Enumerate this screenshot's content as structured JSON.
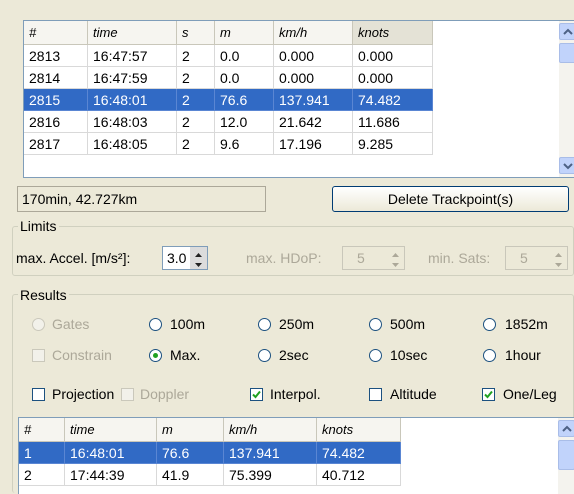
{
  "top_table": {
    "columns": [
      "#",
      "time",
      "s",
      "m",
      "km/h",
      "knots"
    ],
    "rows": [
      [
        "2813",
        "16:47:57",
        "2",
        "0.0",
        "0.000",
        "0.000"
      ],
      [
        "2814",
        "16:47:59",
        "2",
        "0.0",
        "0.000",
        "0.000"
      ],
      [
        "2815",
        "16:48:01",
        "2",
        "76.6",
        "137.941",
        "74.482"
      ],
      [
        "2816",
        "16:48:03",
        "2",
        "12.0",
        "21.642",
        "11.686"
      ],
      [
        "2817",
        "16:48:05",
        "2",
        "9.6",
        "17.196",
        "9.285"
      ]
    ],
    "selected_row_index": 2
  },
  "status": {
    "summary": "170min, 42.727km",
    "delete_button": "Delete Trackpoint(s)"
  },
  "limits": {
    "title": "Limits",
    "max_accel_label": "max. Accel. [m/s²]:",
    "max_accel_value": "3.0",
    "max_hdop_label": "max. HDoP:",
    "max_hdop_value": "5",
    "min_sats_label": "min. Sats:",
    "min_sats_value": "5"
  },
  "results": {
    "title": "Results",
    "radio_row1": [
      "Gates",
      "100m",
      "250m",
      "500m",
      "1852m"
    ],
    "radio_row2": [
      "Constrain",
      "Max.",
      "2sec",
      "10sec",
      "1hour"
    ],
    "checks": [
      "Projection",
      "Doppler",
      "Interpol.",
      "Altitude",
      "One/Leg"
    ]
  },
  "bottom_table": {
    "columns": [
      "#",
      "time",
      "m",
      "km/h",
      "knots"
    ],
    "rows": [
      [
        "1",
        "16:48:01",
        "76.6",
        "137.941",
        "74.482"
      ],
      [
        "2",
        "17:44:39",
        "41.9",
        "75.399",
        "40.712"
      ]
    ],
    "selected_row_index": 0
  },
  "colors": {
    "selection": "#316ac5",
    "window_bg": "#ece9d8",
    "radio_dot": "#21a121"
  }
}
